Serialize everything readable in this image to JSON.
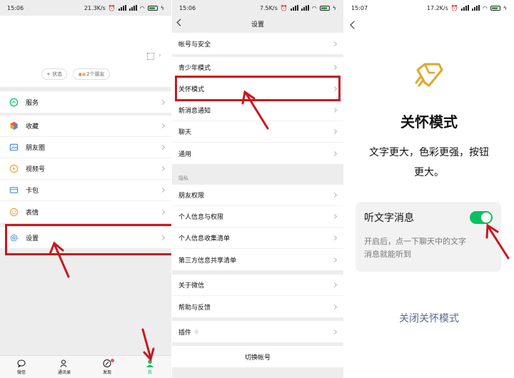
{
  "panel1": {
    "status": {
      "time": "15:06",
      "speed": "21.3K/s"
    },
    "pills": {
      "status": "+ 状态",
      "friends": "2个朋友"
    },
    "menu": [
      {
        "label": "服务",
        "icon": "service-icon"
      },
      {
        "label": "收藏",
        "icon": "favorites-icon"
      },
      {
        "label": "朋友圈",
        "icon": "moments-icon"
      },
      {
        "label": "视频号",
        "icon": "channels-icon"
      },
      {
        "label": "卡包",
        "icon": "cards-icon"
      },
      {
        "label": "表情",
        "icon": "sticker-icon"
      },
      {
        "label": "设置",
        "icon": "gear-icon"
      }
    ],
    "tabs": [
      {
        "label": "微信",
        "icon": "chat-icon"
      },
      {
        "label": "通讯录",
        "icon": "contacts-icon"
      },
      {
        "label": "发现",
        "icon": "compass-icon"
      },
      {
        "label": "我",
        "icon": "me-icon"
      }
    ]
  },
  "panel2": {
    "status": {
      "time": "15:06",
      "speed": "7.5K/s"
    },
    "title": "设置",
    "groupA": [
      "帐号与安全"
    ],
    "groupB": [
      "青少年模式",
      "关怀模式",
      "新消息通知",
      "聊天",
      "通用"
    ],
    "privacy_label": "隐私",
    "groupC": [
      "朋友权限",
      "个人信息与权限",
      "个人信息收集清单",
      "第三方信息共享清单"
    ],
    "groupD": [
      "关于微信",
      "帮助与反馈"
    ],
    "groupE": [
      "插件"
    ],
    "switch_account": "切换帐号"
  },
  "panel3": {
    "status": {
      "time": "15:07",
      "speed": "17.2K/s"
    },
    "title": "关怀模式",
    "subtitle_line1": "文字更大，色彩更强，按钮",
    "subtitle_line2": "更大。",
    "option_title": "听文字消息",
    "option_on": true,
    "option_desc_line1": "开启后，点一下聊天中的文字",
    "option_desc_line2": "消息就能听到",
    "close_label": "关闭关怀模式"
  },
  "colors": {
    "accent": "#07c160",
    "highlight": "#c8171e",
    "link": "#576b95",
    "badge": "#fa5151"
  }
}
